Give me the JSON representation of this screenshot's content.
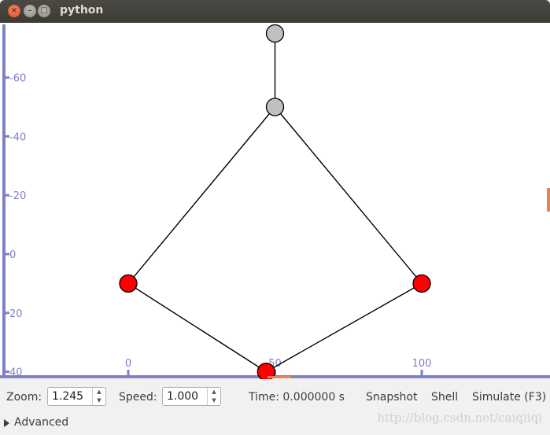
{
  "window": {
    "title": "python"
  },
  "colors": {
    "axis": "#8080c8",
    "edge": "#000000",
    "node_red": "#ff0000",
    "node_gray": "#c0c0c0",
    "marker": "#e8825a"
  },
  "plot": {
    "y_ticks": [
      "-60",
      "-40",
      "-20",
      "0",
      "20",
      "40"
    ],
    "x_ticks": [
      "0",
      "50",
      "100"
    ]
  },
  "graph": {
    "nodes": [
      {
        "id": "top",
        "type": "gray",
        "x": 50,
        "y": -75
      },
      {
        "id": "hub",
        "type": "gray",
        "x": 50,
        "y": -50
      },
      {
        "id": "left",
        "type": "red",
        "x": 0,
        "y": 10
      },
      {
        "id": "right",
        "type": "red",
        "x": 100,
        "y": 10
      },
      {
        "id": "bottom",
        "type": "red",
        "x": 47,
        "y": 40
      }
    ],
    "edges": [
      [
        "top",
        "hub"
      ],
      [
        "hub",
        "left"
      ],
      [
        "hub",
        "right"
      ],
      [
        "left",
        "bottom"
      ],
      [
        "right",
        "bottom"
      ]
    ]
  },
  "controls": {
    "zoom_label": "Zoom:",
    "zoom_value": "1.245",
    "speed_label": "Speed:",
    "speed_value": "1.000",
    "time_text": "Time: 0.000000 s",
    "snapshot": "Snapshot",
    "shell": "Shell",
    "simulate": "Simulate (F3)",
    "advanced": "Advanced"
  },
  "watermark": "http://blog.csdn.net/caiqiiqi"
}
